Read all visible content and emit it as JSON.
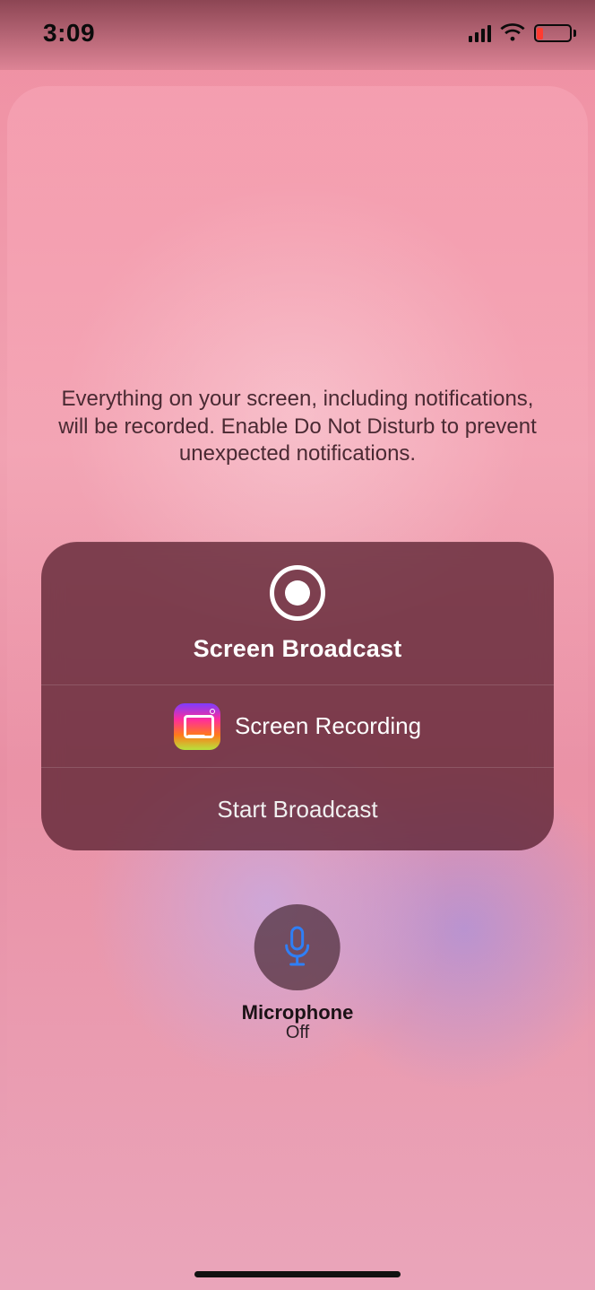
{
  "status": {
    "time": "3:09"
  },
  "warning": "Everything on your screen, including notifications, will be recorded. Enable Do Not Disturb to prevent unexpected notifications.",
  "card": {
    "title": "Screen Broadcast",
    "app_label": "Screen Recording",
    "start_label": "Start Broadcast"
  },
  "mic": {
    "label": "Microphone",
    "state": "Off"
  }
}
